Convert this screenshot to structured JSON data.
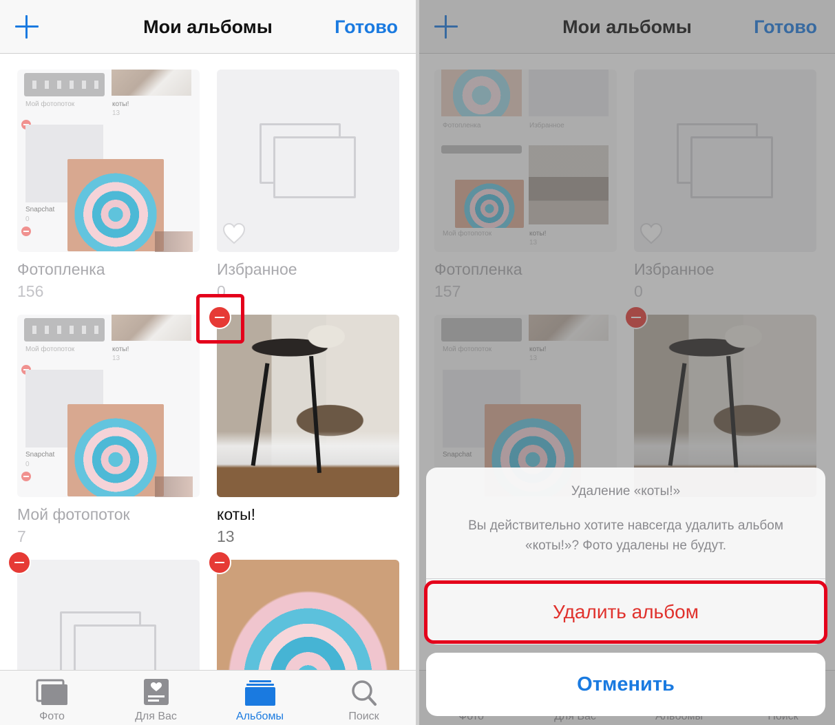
{
  "nav": {
    "title": "Мои альбомы",
    "done_label": "Готово"
  },
  "left": {
    "albums": [
      {
        "title": "Фотопленка",
        "count": "156"
      },
      {
        "title": "Избранное",
        "count": "0"
      },
      {
        "title": "Мой фотопоток",
        "count": "7"
      },
      {
        "title": "коты!",
        "count": "13"
      }
    ],
    "collage": {
      "label_stream": "Мой фотопоток",
      "label_cats": "коты!",
      "count_cats": "13",
      "label_snapchat": "Snapchat",
      "count_snapchat": "0"
    }
  },
  "right": {
    "albums": [
      {
        "title": "Фотопленка",
        "count": "157"
      },
      {
        "title": "Избранное",
        "count": "0"
      }
    ],
    "collage": {
      "label_roll": "Фотопленка",
      "label_favorites": "Избранное",
      "label_stream": "Мой фотопоток",
      "label_cats": "коты!",
      "count_cats": "13",
      "label_snapchat": "Snapchat"
    }
  },
  "tabs": [
    {
      "label": "Фото",
      "icon": "photos-icon"
    },
    {
      "label": "Для Вас",
      "icon": "for-you-icon"
    },
    {
      "label": "Альбомы",
      "icon": "albums-icon",
      "active": true
    },
    {
      "label": "Поиск",
      "icon": "search-icon"
    }
  ],
  "dialog": {
    "title": "Удаление «коты!»",
    "message": "Вы действительно хотите навсегда удалить альбом «коты!»? Фото удалены не будут.",
    "delete_label": "Удалить альбом",
    "cancel_label": "Отменить"
  },
  "colors": {
    "accent": "#1a7ae0",
    "destructive": "#e0322d",
    "highlight": "#e4001b"
  }
}
